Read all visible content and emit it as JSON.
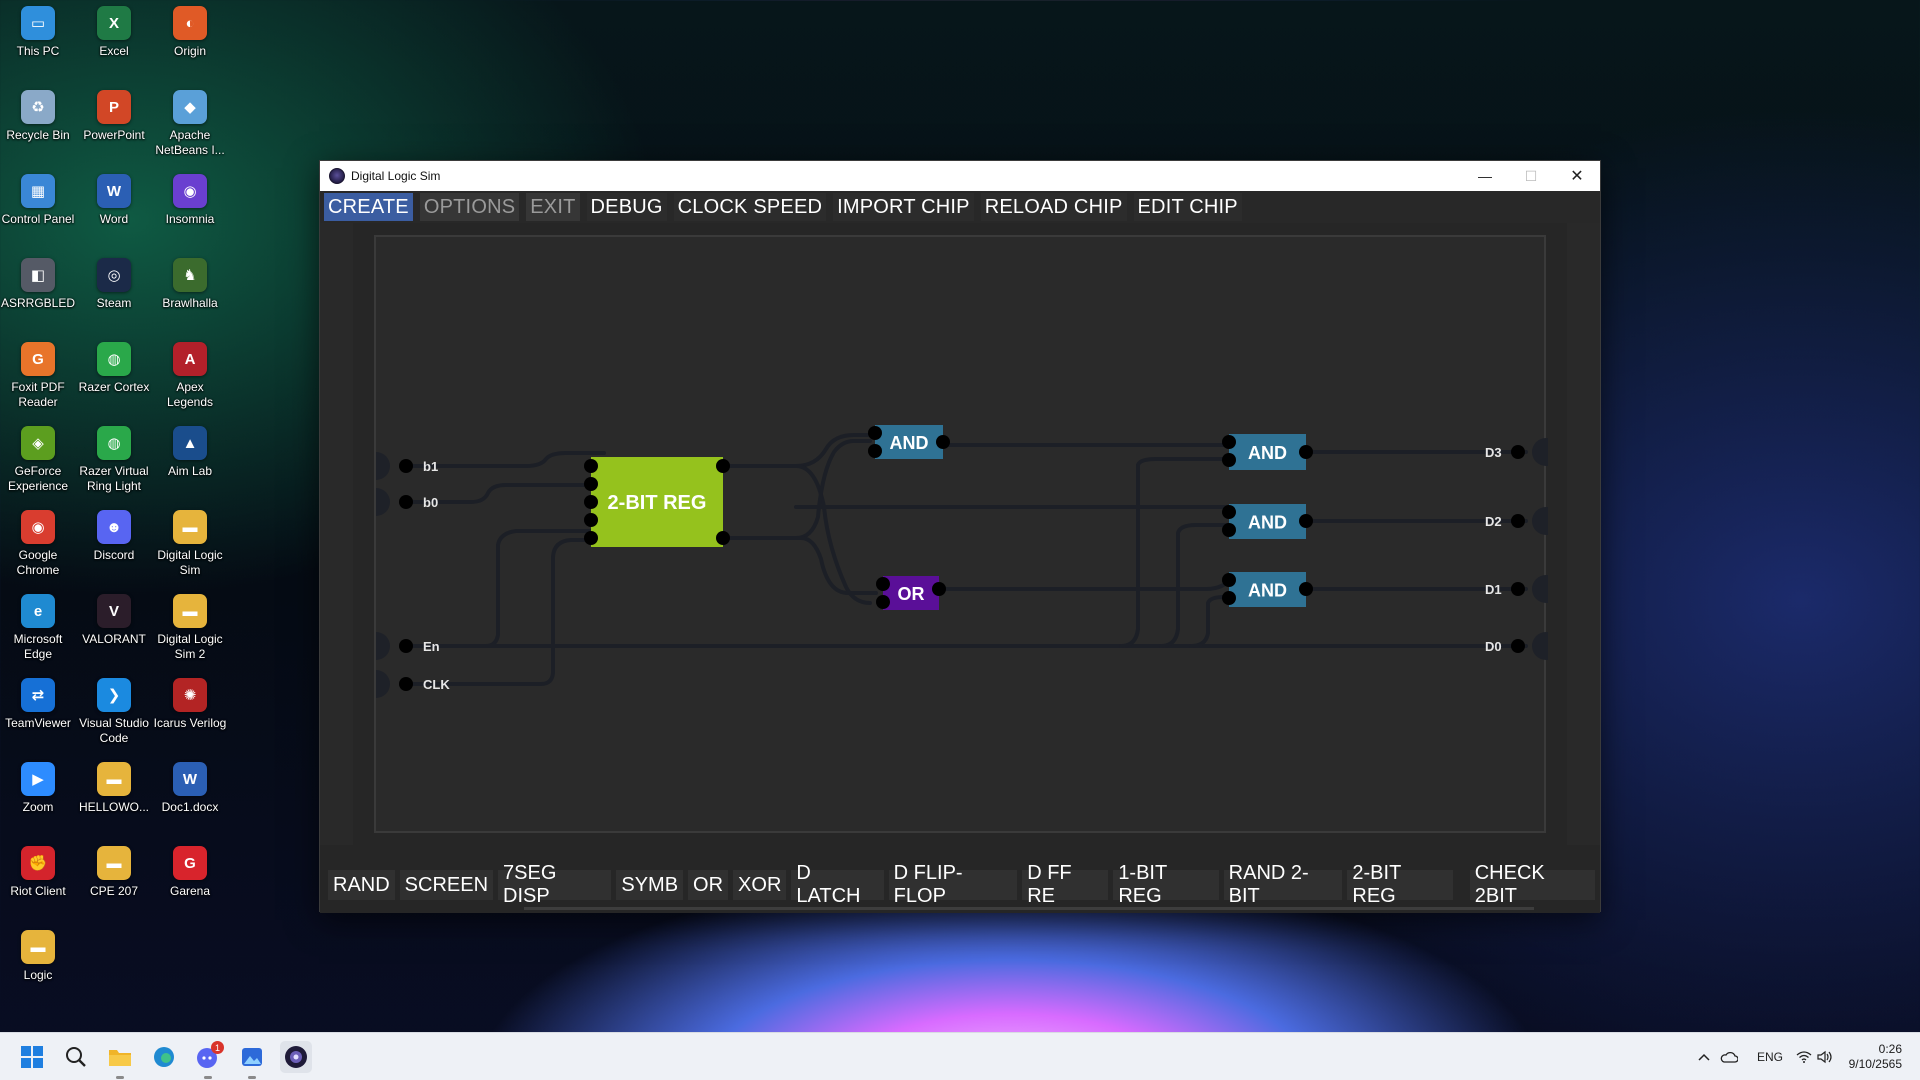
{
  "desktop": {
    "icons": [
      {
        "label": "This PC",
        "glyph": "▭",
        "color": "#2f8fdc"
      },
      {
        "label": "Excel",
        "glyph": "X",
        "color": "#1f7a45"
      },
      {
        "label": "Origin",
        "glyph": "◐",
        "color": "#e05a26"
      },
      {
        "label": "Recycle Bin",
        "glyph": "♻",
        "color": "#8aa9c8"
      },
      {
        "label": "PowerPoint",
        "glyph": "P",
        "color": "#d24726"
      },
      {
        "label": "Apache NetBeans I...",
        "glyph": "◆",
        "color": "#5aa0d8"
      },
      {
        "label": "Control Panel",
        "glyph": "▦",
        "color": "#3a87d6"
      },
      {
        "label": "Word",
        "glyph": "W",
        "color": "#2b5fb4"
      },
      {
        "label": "Insomnia",
        "glyph": "◉",
        "color": "#6a3fd0"
      },
      {
        "label": "ASRRGBLED",
        "glyph": "◧",
        "color": "#555a66"
      },
      {
        "label": "Steam",
        "glyph": "◎",
        "color": "#1b2a48"
      },
      {
        "label": "Brawlhalla",
        "glyph": "♞",
        "color": "#3b6b2d"
      },
      {
        "label": "Foxit PDF Reader",
        "glyph": "G",
        "color": "#e8742a"
      },
      {
        "label": "Razer Cortex",
        "glyph": "◍",
        "color": "#2aa84a"
      },
      {
        "label": "Apex Legends",
        "glyph": "A",
        "color": "#b3202a"
      },
      {
        "label": "GeForce Experience",
        "glyph": "◈",
        "color": "#5c9e1f"
      },
      {
        "label": "Razer Virtual Ring Light",
        "glyph": "◍",
        "color": "#2aa84a"
      },
      {
        "label": "Aim Lab",
        "glyph": "▲",
        "color": "#1a4d8c"
      },
      {
        "label": "Google Chrome",
        "glyph": "◉",
        "color": "#d93d2f"
      },
      {
        "label": "Discord",
        "glyph": "☻",
        "color": "#5865f2"
      },
      {
        "label": "Digital Logic Sim",
        "glyph": "▬",
        "color": "#e6b43c"
      },
      {
        "label": "Microsoft Edge",
        "glyph": "e",
        "color": "#1f8ad1"
      },
      {
        "label": "VALORANT",
        "glyph": "V",
        "color": "#2b1d2a"
      },
      {
        "label": "Digital Logic Sim 2",
        "glyph": "▬",
        "color": "#e6b43c"
      },
      {
        "label": "TeamViewer",
        "glyph": "⇄",
        "color": "#1670d6"
      },
      {
        "label": "Visual Studio Code",
        "glyph": "❯",
        "color": "#1b8ae0"
      },
      {
        "label": "Icarus Verilog",
        "glyph": "✺",
        "color": "#b32424"
      },
      {
        "label": "Zoom",
        "glyph": "▶",
        "color": "#2d8cff"
      },
      {
        "label": "HELLOWO...",
        "glyph": "▬",
        "color": "#e6b43c"
      },
      {
        "label": "Doc1.docx",
        "glyph": "W",
        "color": "#2b5fb4"
      },
      {
        "label": "Riot Client",
        "glyph": "✊",
        "color": "#d4242c"
      },
      {
        "label": "CPE 207",
        "glyph": "▬",
        "color": "#e6b43c"
      },
      {
        "label": "Garena",
        "glyph": "G",
        "color": "#d8242c"
      },
      {
        "label": "Logic",
        "glyph": "▬",
        "color": "#e6b43c"
      }
    ]
  },
  "window": {
    "title": "Digital Logic Sim",
    "min_glyph": "—",
    "max_glyph": "☐",
    "close_glyph": "✕"
  },
  "menu": {
    "items": [
      {
        "label": "CREATE",
        "state": "active"
      },
      {
        "label": "OPTIONS",
        "state": "dim"
      },
      {
        "label": "EXIT",
        "state": "dim"
      },
      {
        "label": "DEBUG",
        "state": "normal"
      },
      {
        "label": "CLOCK SPEED",
        "state": "normal"
      },
      {
        "label": "IMPORT CHIP",
        "state": "normal"
      },
      {
        "label": "RELOAD CHIP",
        "state": "normal"
      },
      {
        "label": "EDIT CHIP",
        "state": "normal"
      }
    ]
  },
  "circuit": {
    "inputs": [
      "b1",
      "b0",
      "En",
      "CLK"
    ],
    "outputs": [
      "D3",
      "D2",
      "D1",
      "D0"
    ],
    "chips": [
      {
        "label": "2-BIT REG",
        "color": "#95c21d"
      },
      {
        "label": "AND",
        "color": "#2f7294"
      },
      {
        "label": "OR",
        "color": "#5a0f98"
      },
      {
        "label": "AND",
        "color": "#2f7294"
      },
      {
        "label": "AND",
        "color": "#2f7294"
      },
      {
        "label": "AND",
        "color": "#2f7294"
      }
    ]
  },
  "bottom": {
    "items": [
      "RAND",
      "SCREEN",
      "7SEG DISP",
      "SYMB",
      "OR",
      "XOR",
      "D LATCH",
      "D FLIP-FLOP",
      "D FF RE",
      "1-BIT REG",
      "RAND 2-BIT",
      "2-BIT REG",
      "CHECK 2BIT"
    ]
  },
  "taskbar": {
    "badge": "1",
    "tray_lang": "ENG",
    "time": "0:26",
    "date": "9/10/2565"
  }
}
